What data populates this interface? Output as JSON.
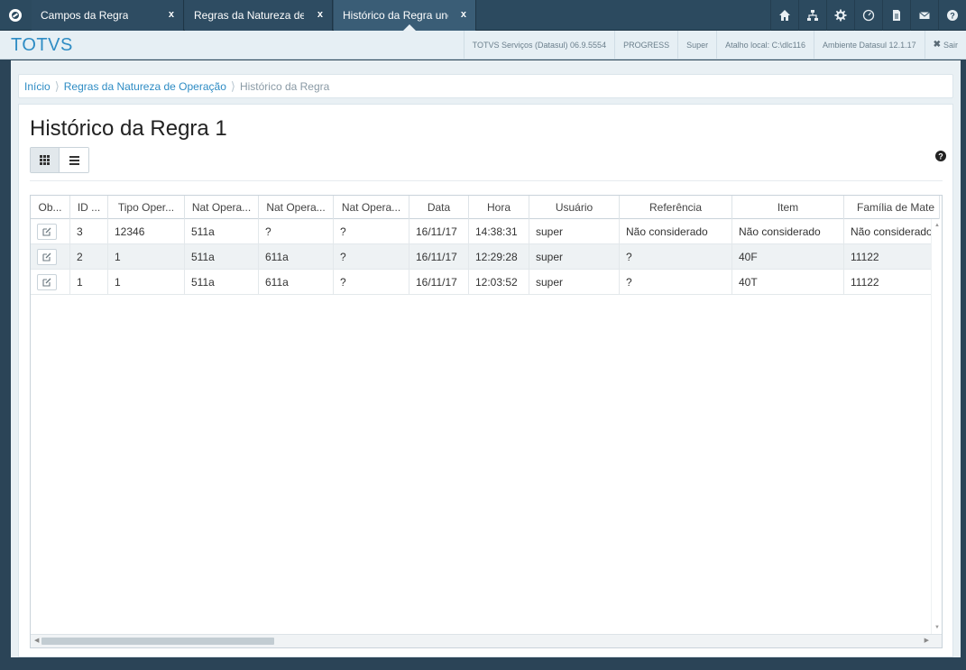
{
  "tabs": [
    {
      "label": "Campos da Regra",
      "close": "x"
    },
    {
      "label": "Regras da Natureza de",
      "close": "x"
    },
    {
      "label": "Histórico da Regra unc",
      "close": "x"
    }
  ],
  "top_icons": [
    "home-icon",
    "sitemap-icon",
    "gear-icon",
    "dashboard-icon",
    "document-icon",
    "mail-icon",
    "question-icon"
  ],
  "header": {
    "brand": "TOTVS",
    "info": [
      "TOTVS Serviços (Datasul) 06.9.5554",
      "PROGRESS",
      "Super",
      "Atalho local: C:\\dlc116",
      "Ambiente Datasul 12.1.17"
    ],
    "logout_icon": "✖",
    "logout_label": "Sair"
  },
  "breadcrumb": [
    "Início",
    "Regras da Natureza de Operação",
    "Histórico da Regra"
  ],
  "page_title": "Histórico da Regra 1",
  "grid": {
    "columns": [
      "Ob...",
      "ID ...",
      "Tipo Oper...",
      "Nat Opera...",
      "Nat Opera...",
      "Nat Opera...",
      "Data",
      "Hora",
      "Usuário",
      "Referência",
      "Item",
      "Família de Mate"
    ],
    "rows": [
      [
        "",
        "3",
        "12346",
        "511a",
        "?",
        "?",
        "16/11/17",
        "14:38:31",
        "super",
        "Não considerado",
        "Não considerado",
        "Não considerado"
      ],
      [
        "",
        "2",
        "1",
        "511a",
        "611a",
        "?",
        "16/11/17",
        "12:29:28",
        "super",
        "?",
        "40F",
        "11122"
      ],
      [
        "",
        "1",
        "1",
        "511a",
        "611a",
        "?",
        "16/11/17",
        "12:03:52",
        "super",
        "?",
        "40T",
        "11122"
      ]
    ]
  }
}
